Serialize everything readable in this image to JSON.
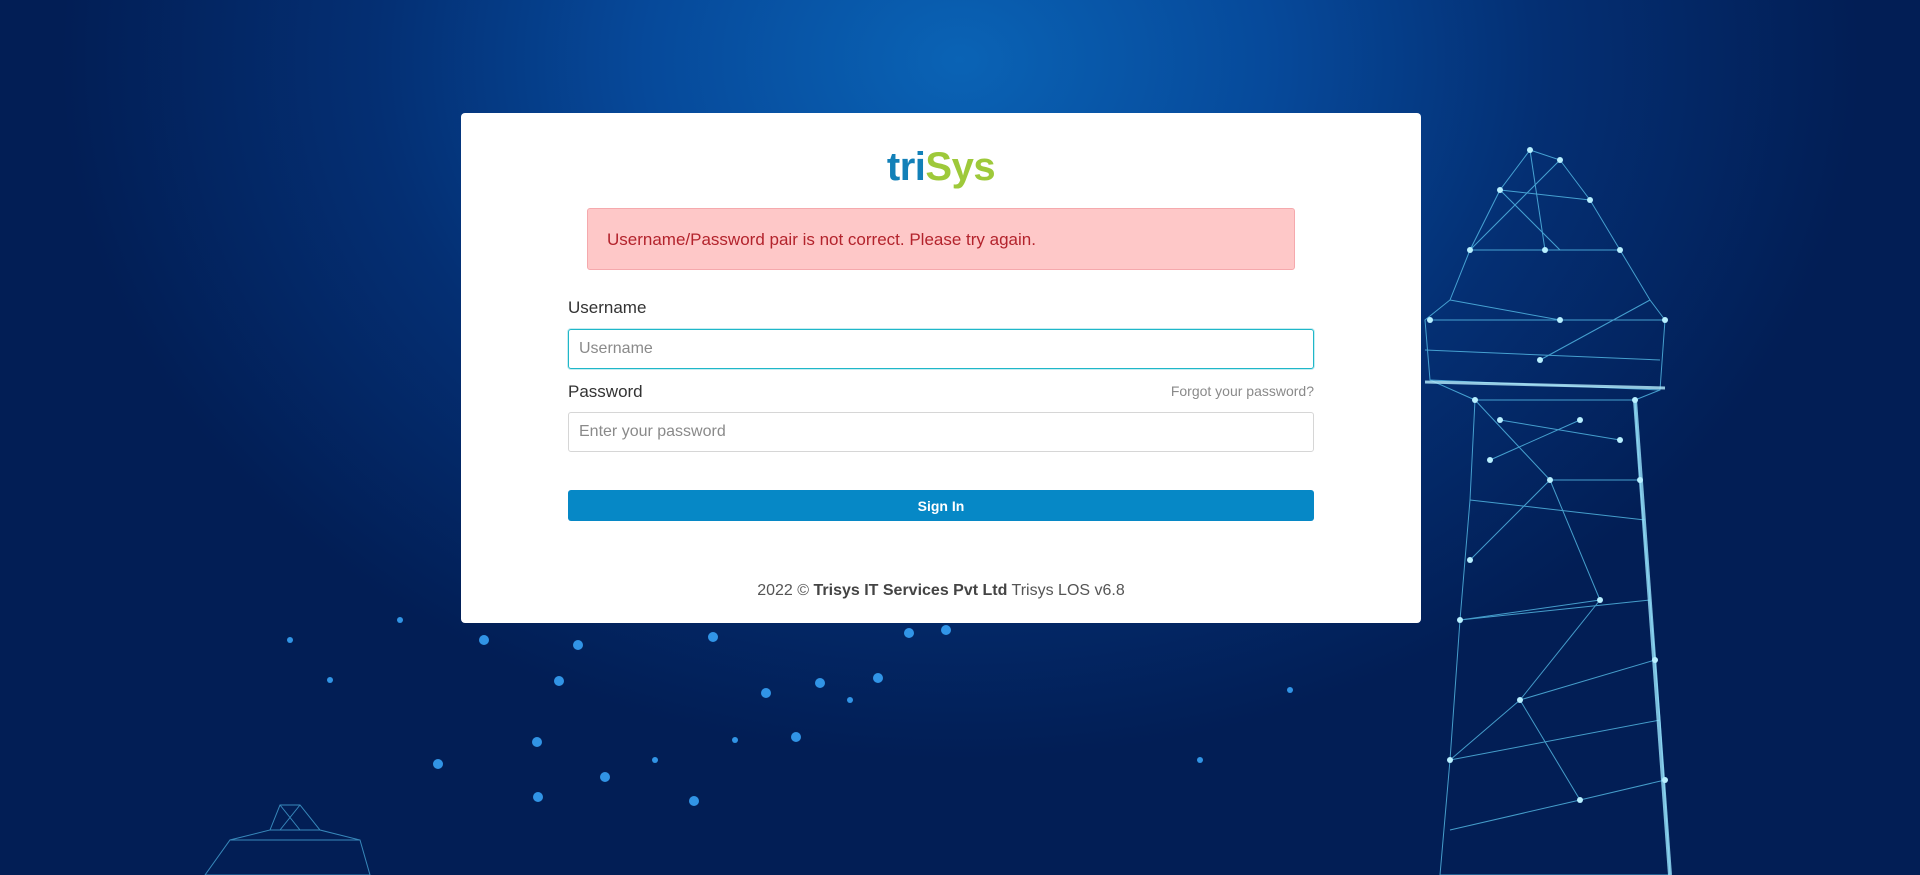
{
  "logo": {
    "part1": "tri",
    "part2": "Sys"
  },
  "alert": {
    "message": "Username/Password pair is not correct. Please try again."
  },
  "form": {
    "username_label": "Username",
    "username_placeholder": "Username",
    "username_value": "",
    "password_label": "Password",
    "password_placeholder": "Enter your password",
    "password_value": "",
    "forgot_link": "Forgot your password?",
    "submit_label": "Sign In"
  },
  "footer": {
    "year": "2022 ©",
    "company": "Trisys IT Services Pvt Ltd",
    "product": "Trisys LOS v6.8"
  },
  "colors": {
    "brand_blue": "#1280b8",
    "brand_green": "#9ec93a",
    "button": "#0688c6",
    "alert_bg": "#fec8c8",
    "alert_text": "#b3232c",
    "focus_border": "#1fb7c9"
  },
  "background": {
    "illustration": "network-lighthouse-illustration"
  }
}
